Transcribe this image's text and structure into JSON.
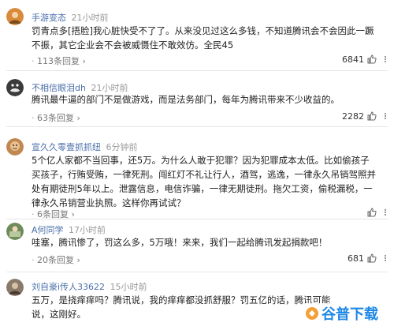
{
  "comments": [
    {
      "username": "手游变态",
      "time": "21小时前",
      "text": "罚青点多[捂脸]我心脏快受不了了。从来没见过这么多钱，不知道腾讯会不会因此一蹶不振，其它企业会不会被威慑住不敢效仿。全民45",
      "replies": "113条回复",
      "likes": "6841",
      "avatar_color": "#d98a3a"
    },
    {
      "username": "不相信眼泪dh",
      "time": "21小时前",
      "text": "腾讯最牛逼的部门不是做游戏，而是法务部门，每年为腾讯带来不少收益的。",
      "replies": "63条回复",
      "likes": "2282",
      "avatar_color": "#3b3b3b"
    },
    {
      "username": "宣久久零壹抓抓纽",
      "time": "6分钟前",
      "text": "5个亿人家都不当回事，还5万。为什么人敢于犯罪？因为犯罪成本太低。比如偷孩子买孩子，行贿受贿，一律死刑。闯红灯不礼让行人，酒驾，逃逸，一律永久吊销驾照并处有期徒刑5年以上。泄露信息，电信诈骗，一律无期徒刑。拖欠工资，偷税漏税，一律永久吊销营业执照。这样你再试试？",
      "replies": "6条回复",
      "likes": "",
      "avatar_color": "#c08850"
    },
    {
      "username": "A何同学",
      "time": "17小时前",
      "text": "哇塞，腾讯惨了，罚这么多，5万哦！来来，我们一起给腾讯发起捐款吧！",
      "replies": "20条回复",
      "likes": "681",
      "avatar_color": "#6f8b5a"
    },
    {
      "username": "刘自豪i传人33622",
      "time": "15小时前",
      "text": "五万，是挠痒痒吗？腾讯说，我的痒痒都没抓舒服？罚五亿的话，腾讯可能说，这刚好。",
      "replies": "",
      "likes": "",
      "avatar_color": "#8a7a6a"
    }
  ],
  "separator": "·",
  "watermark": {
    "text": "谷普下载",
    "primary_color": "#1e88e5",
    "accent_color": "#f2a03a"
  }
}
